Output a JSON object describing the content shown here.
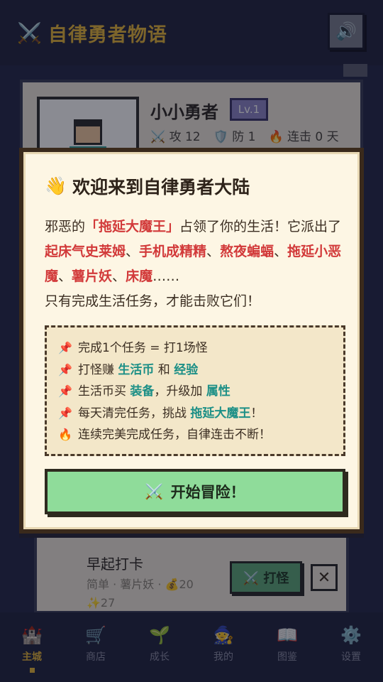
{
  "header": {
    "title": "自律勇者物语",
    "title_icon": "⚔️",
    "sound_icon": "🔊"
  },
  "profile": {
    "name": "小小勇者",
    "level": "Lv.1",
    "stats": [
      {
        "icon": "⚔️",
        "text": "攻 12"
      },
      {
        "icon": "🛡️",
        "text": "防 1"
      },
      {
        "icon": "🔥",
        "text": "连击 0 天"
      }
    ]
  },
  "quest": {
    "title": "早起打卡",
    "meta_line1": "简单 · 薯片妖 · 💰20",
    "meta_line2": "✨27",
    "fight_label": "⚔️ 打怪",
    "close_label": "✕"
  },
  "nav": [
    {
      "icon": "🏰",
      "label": "主城",
      "active": true
    },
    {
      "icon": "🛒",
      "label": "商店",
      "active": false
    },
    {
      "icon": "🌱",
      "label": "成长",
      "active": false
    },
    {
      "icon": "🧙",
      "label": "我的",
      "active": false
    },
    {
      "icon": "📖",
      "label": "图鉴",
      "active": false
    },
    {
      "icon": "⚙️",
      "label": "设置",
      "active": false
    }
  ],
  "modal": {
    "title_icon": "👋",
    "title": "欢迎来到自律勇者大陆",
    "intro": {
      "p1_a": "邪恶的",
      "boss": "「拖延大魔王」",
      "p1_b": "占领了你的生活！它派出了",
      "m1": "起床气史莱姆",
      "sep": "、",
      "m2": "手机成精精",
      "m3": "熬夜蝙蝠",
      "m4": "拖延小恶魔",
      "m5": "薯片妖",
      "m6": "床魔",
      "ellipsis": "……",
      "p2": "只有完成生活任务，才能击败它们！"
    },
    "rules": [
      {
        "icon": "📌",
        "parts": [
          "完成1个任务 = 打1场怪"
        ]
      },
      {
        "icon": "📌",
        "parts": [
          "打怪赚 ",
          "生活币",
          " 和 ",
          "经验"
        ]
      },
      {
        "icon": "📌",
        "parts": [
          "生活币买 ",
          "装备",
          "，升级加 ",
          "属性"
        ]
      },
      {
        "icon": "📌",
        "parts": [
          "每天清完任务，挑战 ",
          "拖延大魔王",
          "！"
        ]
      },
      {
        "icon": "🔥",
        "parts": [
          "连续完美完成任务，自律连击不断！"
        ]
      }
    ],
    "start_icon": "⚔️",
    "start_label": "开始冒险！"
  }
}
